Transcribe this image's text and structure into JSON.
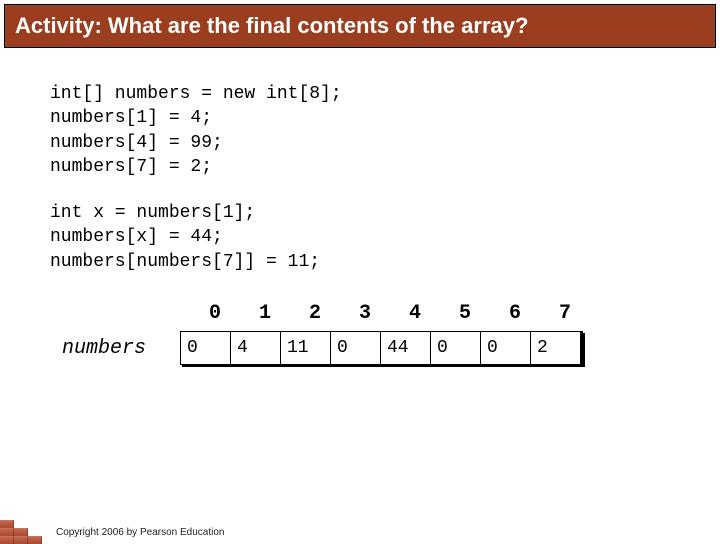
{
  "title": "Activity: What are the final contents of the array?",
  "code": {
    "block1": "int[] numbers = new int[8];\nnumbers[1] = 4;\nnumbers[4] = 99;\nnumbers[7] = 2;",
    "block2": "int x = numbers[1];\nnumbers[x] = 44;\nnumbers[numbers[7]] = 11;"
  },
  "array": {
    "label": "numbers",
    "indices": [
      "0",
      "1",
      "2",
      "3",
      "4",
      "5",
      "6",
      "7"
    ],
    "values": [
      "0",
      "4",
      "11",
      "0",
      "44",
      "0",
      "0",
      "2"
    ]
  },
  "copyright": "Copyright 2006 by Pearson Education"
}
